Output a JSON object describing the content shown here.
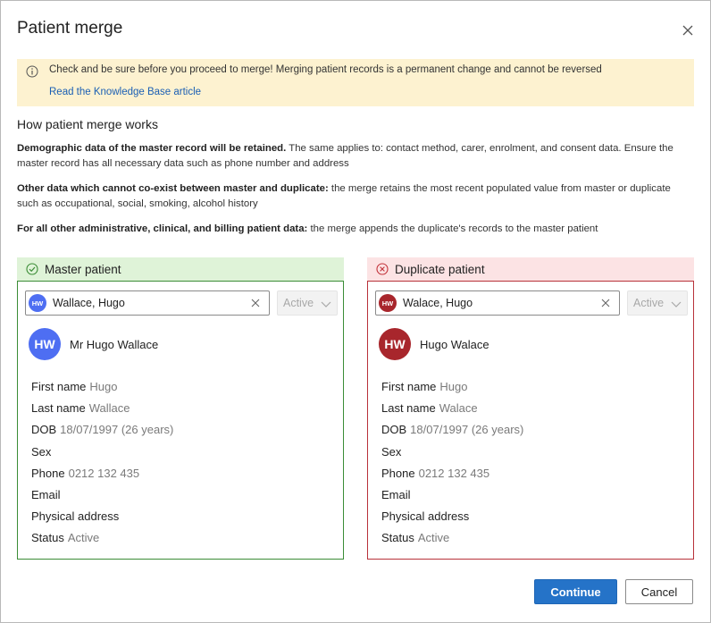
{
  "dialog": {
    "title": "Patient merge"
  },
  "warning": {
    "message": "Check and be sure before you proceed to merge! Merging patient records is a permanent change and cannot be reversed",
    "link_label": "Read the Knowledge Base article"
  },
  "how": {
    "title": "How patient merge works",
    "p1_bold": "Demographic data of the master record will be retained.",
    "p1_rest": " The same applies to: contact method, carer, enrolment, and consent data. Ensure the master record has all necessary data such as phone number and address",
    "p2_bold": "Other data which cannot co-exist between master and duplicate:",
    "p2_rest": " the merge retains the most recent populated value from master or duplicate such as occupational, social, smoking, alcohol history",
    "p3_bold": "For all other administrative, clinical, and billing patient data:",
    "p3_rest": " the merge appends the duplicate's records to the master patient"
  },
  "master": {
    "heading": "Master patient",
    "header_bg": "#dff3d8",
    "border_color": "#3b8c36",
    "icon_color": "#3b8c36",
    "avatar_color": "#4e6ef2",
    "initials": "HW",
    "search_value": "Wallace, Hugo",
    "status_select": "Active",
    "full_name": "Mr Hugo Wallace",
    "fields": {
      "first_name": {
        "label": "First name",
        "value": "Hugo"
      },
      "last_name": {
        "label": "Last name",
        "value": "Wallace"
      },
      "dob": {
        "label": "DOB",
        "value": "18/07/1997 (26 years)"
      },
      "sex": {
        "label": "Sex",
        "value": ""
      },
      "phone": {
        "label": "Phone",
        "value": "0212 132 435"
      },
      "email": {
        "label": "Email",
        "value": ""
      },
      "address": {
        "label": "Physical address",
        "value": ""
      },
      "status": {
        "label": "Status",
        "value": "Active"
      }
    }
  },
  "duplicate": {
    "heading": "Duplicate patient",
    "header_bg": "#fce3e4",
    "border_color": "#b8323a",
    "icon_color": "#c2343b",
    "avatar_color": "#a8262c",
    "initials": "HW",
    "search_value": "Walace, Hugo",
    "status_select": "Active",
    "full_name": "Hugo Walace",
    "fields": {
      "first_name": {
        "label": "First name",
        "value": "Hugo"
      },
      "last_name": {
        "label": "Last name",
        "value": "Walace"
      },
      "dob": {
        "label": "DOB",
        "value": "18/07/1997 (26 years)"
      },
      "sex": {
        "label": "Sex",
        "value": ""
      },
      "phone": {
        "label": "Phone",
        "value": "0212 132 435"
      },
      "email": {
        "label": "Email",
        "value": ""
      },
      "address": {
        "label": "Physical address",
        "value": ""
      },
      "status": {
        "label": "Status",
        "value": "Active"
      }
    }
  },
  "actions": {
    "continue_label": "Continue",
    "cancel_label": "Cancel",
    "primary_color": "#2573c8"
  },
  "icons": {
    "close": "close-icon",
    "info": "info-icon",
    "master": "check-circle-icon",
    "duplicate": "x-circle-icon",
    "clear": "clear-icon",
    "dropdown": "chevron-down-icon"
  }
}
